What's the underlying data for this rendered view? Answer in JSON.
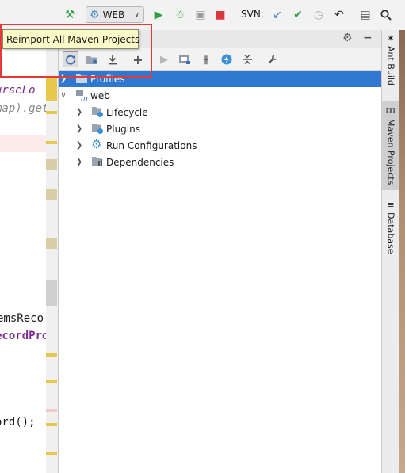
{
  "toolbar": {
    "build_icon": "hammer-icon",
    "run_config_label": "WEB",
    "svn_label": "SVN:",
    "colors": {
      "run": "#2e9e3e",
      "stop": "#d9363e",
      "svn_update": "#3b82d8",
      "svn_commit": "#2e9e3e"
    }
  },
  "editor": {
    "lines": [
      {
        "text": "urseLo",
        "color": "#7b2d8e",
        "italic": true
      },
      {
        "text": "map).get",
        "color": "#8a8a8a",
        "italic": true
      },
      {
        "text": "emsReco",
        "color": "#1a1a1a",
        "italic": false
      },
      {
        "text": "ecordPro",
        "color": "#7b2d8e",
        "italic": false
      },
      {
        "text": "ord();",
        "color": "#1a1a1a",
        "italic": false
      }
    ]
  },
  "tooltip": {
    "text": "Reimport All Maven Projects"
  },
  "maven": {
    "tree": [
      {
        "label": "Profiles",
        "icon": "folder-icon",
        "selected": true
      },
      {
        "label": "web",
        "icon": "maven-module-icon",
        "selected": false
      },
      {
        "label": "Lifecycle",
        "icon": "lifecycle-folder-icon",
        "selected": false
      },
      {
        "label": "Plugins",
        "icon": "plugins-folder-icon",
        "selected": false
      },
      {
        "label": "Run Configurations",
        "icon": "gear-icon",
        "selected": false
      },
      {
        "label": "Dependencies",
        "icon": "dependencies-folder-icon",
        "selected": false
      }
    ]
  },
  "right_strip": {
    "tabs": [
      {
        "label": "Ant Build",
        "icon": "ant-icon"
      },
      {
        "label": "Maven Projects",
        "icon": "maven-icon"
      },
      {
        "label": "Database",
        "icon": "database-icon"
      }
    ],
    "maven_glyph": "m"
  }
}
